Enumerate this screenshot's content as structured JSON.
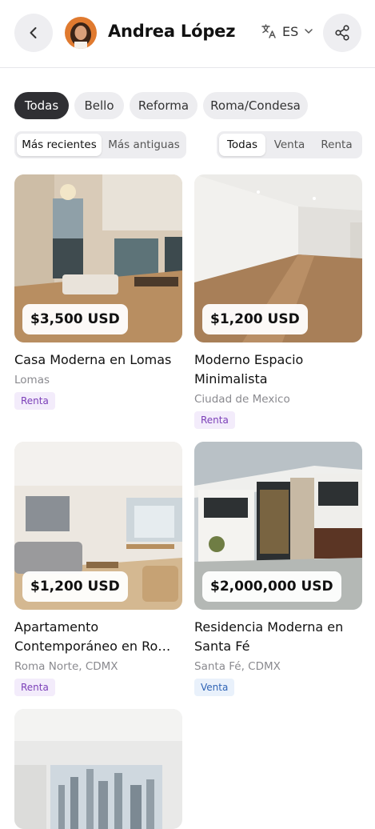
{
  "header": {
    "user_name": "Andrea López",
    "language": "ES"
  },
  "filters": {
    "areas": [
      "Todas",
      "Bello",
      "Reforma",
      "Roma/Condesa"
    ],
    "sort": [
      "Más recientes",
      "Más antiguas"
    ],
    "type": [
      "Todas",
      "Venta",
      "Renta"
    ]
  },
  "listings": [
    {
      "price": "$3,500 USD",
      "title": "Casa Moderna en Lomas",
      "location": "Lomas",
      "badge": "Renta"
    },
    {
      "price": "$1,200 USD",
      "title": "Moderno Espacio Minimalista",
      "location": "Ciudad de Mexico",
      "badge": "Renta"
    },
    {
      "price": "$1,200 USD",
      "title": "Apartamento Contemporáneo en Roma Norte",
      "location": "Roma Norte, CDMX",
      "badge": "Renta"
    },
    {
      "price": "$2,000,000 USD",
      "title": "Residencia Moderna en Santa Fé",
      "location": "Santa Fé, CDMX",
      "badge": "Venta"
    }
  ]
}
